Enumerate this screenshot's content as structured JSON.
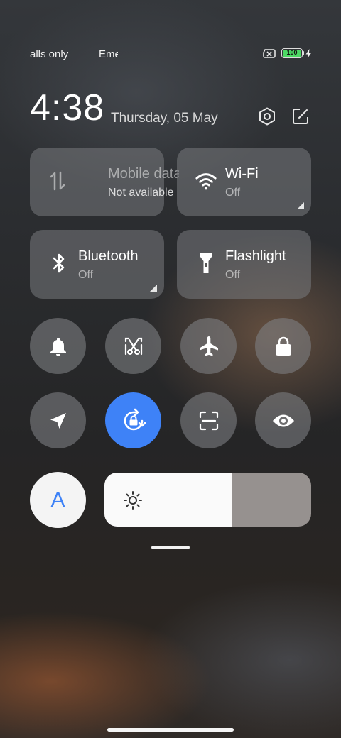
{
  "status_bar": {
    "carrier_1": "alls only",
    "carrier_2": "Emergency calls only",
    "battery_level": "100",
    "battery_color": "#4cd964"
  },
  "header": {
    "time": "4:38",
    "date": "Thursday, 05 May",
    "settings_icon": "settings-hexagon-icon",
    "edit_icon": "edit-icon"
  },
  "tiles": {
    "mobile_data": {
      "label": "Mobile data",
      "status": "Not available",
      "icon": "data-arrows-icon"
    },
    "wifi": {
      "label": "Wi-Fi",
      "status": "Off",
      "icon": "wifi-icon"
    },
    "bluetooth": {
      "label": "Bluetooth",
      "status": "Off",
      "icon": "bluetooth-icon"
    },
    "flashlight": {
      "label": "Flashlight",
      "status": "Off",
      "icon": "flashlight-icon"
    }
  },
  "toggles": [
    {
      "name": "sound",
      "icon": "bell-icon",
      "active": false
    },
    {
      "name": "screenshot",
      "icon": "scissors-icon",
      "active": false
    },
    {
      "name": "airplane-mode",
      "icon": "airplane-icon",
      "active": false
    },
    {
      "name": "lock-screen",
      "icon": "lock-icon",
      "active": false
    },
    {
      "name": "location",
      "icon": "location-arrow-icon",
      "active": false
    },
    {
      "name": "rotation-lock",
      "icon": "rotation-lock-icon",
      "active": true
    },
    {
      "name": "scanner",
      "icon": "scan-icon",
      "active": false
    },
    {
      "name": "reading-mode",
      "icon": "eye-icon",
      "active": false
    }
  ],
  "brightness": {
    "auto_label": "A",
    "level_fraction": 0.62,
    "icon": "sun-icon"
  },
  "colors": {
    "accent": "#3e82f7"
  }
}
